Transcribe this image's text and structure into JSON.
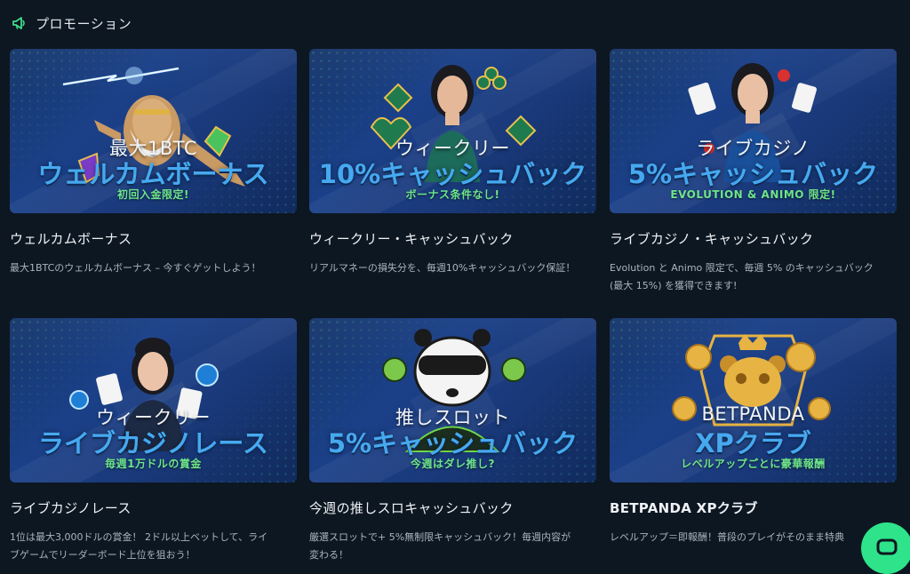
{
  "header": {
    "title": "プロモーション",
    "icon": "megaphone-icon",
    "icon_color": "#3fdc8a"
  },
  "colors": {
    "background": "#0d1721",
    "banner_main_text": "#46a9f0",
    "banner_sub_text": "#6ee58a",
    "accent": "#2ee38a"
  },
  "promotions": [
    {
      "banner_top": "最大1BTC",
      "banner_main": "ウェルカムボーナス",
      "banner_sub": "初回入金限定!",
      "title": "ウェルカムボーナス",
      "description": "最大1BTCのウェルカムボーナス – 今すぐゲットしよう！",
      "art": "zeus-lightning-gems"
    },
    {
      "banner_top": "ウィークリー",
      "banner_main": "10%キャッシュバック",
      "banner_sub": "ボーナス条件なし!",
      "title": "ウィークリー・キャッシュバック",
      "description": "リアルマネーの損失分を、毎週10%キャッシュバック保証！",
      "art": "dealer-card-suits"
    },
    {
      "banner_top": "ライブカジノ",
      "banner_main": "5%キャッシュバック",
      "banner_sub": "EVOLUTION & ANIMO 限定!",
      "title": "ライブカジノ・キャッシュバック",
      "description": "Evolution と Animo 限定で、毎週 5% のキャッシュバック (最大 15%) を獲得できます!",
      "art": "dealer-cards-chips"
    },
    {
      "banner_top": "ウィークリー",
      "banner_main": "ライブカジノレース",
      "banner_sub": "毎週1万ドルの賞金",
      "title": "ライブカジノレース",
      "description": "1位は最大3,000ドルの賞金！ 2ドル以上ベットして、ライブゲームでリーダーボード上位を狙おう！",
      "art": "dealer-aces-chips"
    },
    {
      "banner_top": "推しスロット",
      "banner_main": "5%キャッシュバック",
      "banner_sub": "今週はダレ推し?",
      "title": "今週の推しスロキャッシュバック",
      "description": "厳選スロットで+ 5%無制限キャッシュバック！毎週内容が変わる！",
      "art": "panda-coins"
    },
    {
      "banner_top": "BETPANDA",
      "banner_main": "XPクラブ",
      "banner_sub": "レベルアップごとに豪華報酬",
      "title": "BETPANDA XPクラブ",
      "description": "レベルアップ＝即報酬！普段のプレイがそのまま特典",
      "art": "golden-panda-badge"
    }
  ],
  "chat": {
    "icon": "chat-icon"
  }
}
